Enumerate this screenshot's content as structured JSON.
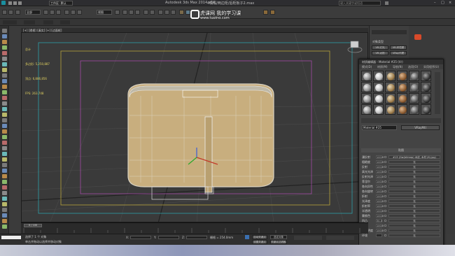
{
  "window": {
    "app_title": "Autodesk 3ds Max 2014 x64",
    "file_title": "4榻榻/两边柜/后柜板子2.max",
    "search_placeholder": "键入关键字或短语"
  },
  "toolbar": {
    "workspace_label": "工作区: 默认",
    "selection_filter": "全部",
    "view_dropdown": "视图",
    "named_selection": ""
  },
  "watermark": {
    "title": "虎课网  我的学习课",
    "url": "www.tuping.com"
  },
  "viewport": {
    "label": "[+] [透视] [真实] [+] [边面框]",
    "stats": [
      "总计",
      "多边形: 5,250,887",
      "顶点: 6,886,856",
      "FPS: 263.748"
    ]
  },
  "command_panel": {
    "object_type": "对象类型",
    "buttons": [
      "VR-灯光",
      "VR-环境雾",
      "VR-太阳",
      "VRay代理"
    ]
  },
  "material_editor": {
    "title": "材质编辑器 - Material #25 (Vr)",
    "menu": [
      "模式(D)",
      "材质(M)",
      "导航(N)",
      "选项(O)",
      "实用程序(U)"
    ],
    "material_name": "Material #25",
    "material_type": "VRayMtl",
    "map_section": "贴图",
    "diffuse_map": "#13 (Gw(bitmap) 木纹, 木材 (6).jpg)",
    "rows": [
      {
        "k": "漫反射",
        "v": "100.0"
      },
      {
        "k": "粗糙度",
        "v": "100.0"
      },
      {
        "k": "反射",
        "v": "100.0"
      },
      {
        "k": "高光光泽",
        "v": "100.0"
      },
      {
        "k": "反射光泽",
        "v": "100.0"
      },
      {
        "k": "菲涅尔",
        "v": "100.0"
      },
      {
        "k": "各向异性",
        "v": "100.0"
      },
      {
        "k": "各向旋转",
        "v": "100.0"
      },
      {
        "k": "折射",
        "v": "100.0"
      },
      {
        "k": "光泽度",
        "v": "100.0"
      },
      {
        "k": "折射率",
        "v": "100.0"
      },
      {
        "k": "半透明",
        "v": "100.0"
      },
      {
        "k": "雾颜色",
        "v": "100.0"
      },
      {
        "k": "凹凸",
        "v": "30.0"
      },
      {
        "k": "置换",
        "v": "100.0"
      },
      {
        "k": "不透明度",
        "v": "100.0"
      },
      {
        "k": "环境",
        "v": ""
      }
    ],
    "none_label": "无"
  },
  "timeline": {
    "frame": "0 / 100"
  },
  "status": {
    "line1": "选择了 1 个 对象",
    "line2": "单击并拖动以选择并移动对象",
    "coord_x": "X:",
    "coord_y": "Y:",
    "coord_z": "Z:",
    "grid": "栅格 = 254.0mm",
    "autokey": "自动关键点",
    "setkey": "设置关键点",
    "selected": "选定对象",
    "keyfilter": "关键点过滤器..."
  },
  "colors": {
    "cabinet_fill": "#c8ae7e",
    "cabinet_edge": "#d9d2c2",
    "safe_frame_yellow": "#b8a33a",
    "safe_frame_purple": "#a24ba5",
    "safe_frame_cyan": "#2ea0a8"
  }
}
